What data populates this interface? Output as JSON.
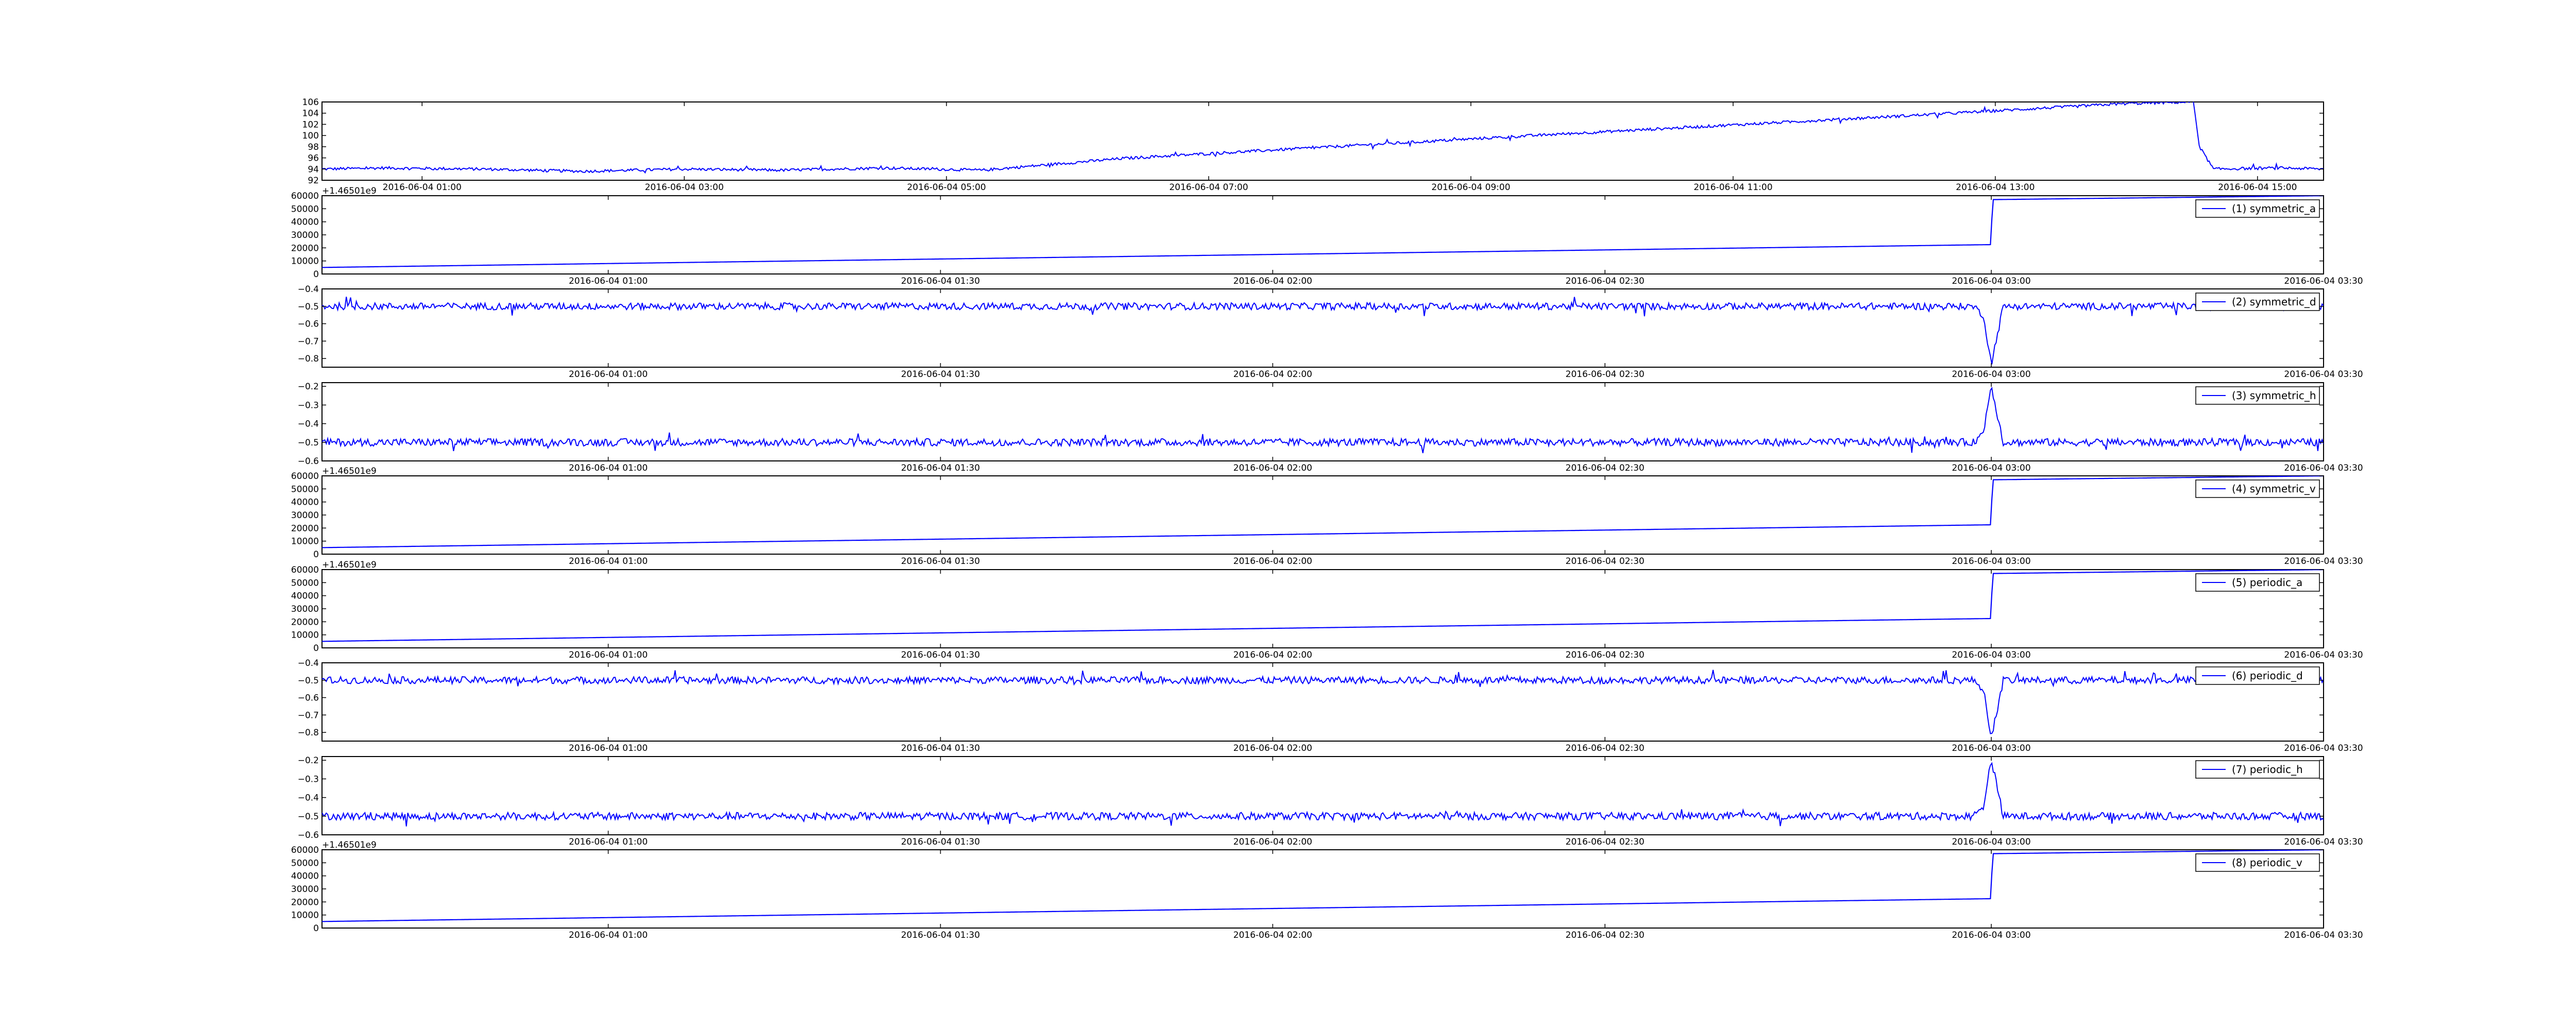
{
  "colors": {
    "series": "#0000ff",
    "axes": "#000000",
    "background": "#ffffff"
  },
  "chart_data": [
    {
      "type": "line",
      "legend": "",
      "offset_text": "",
      "ylim": [
        92,
        106
      ],
      "yticks": [
        92,
        94,
        96,
        98,
        100,
        102,
        104,
        106
      ],
      "ytick_labels": [
        "92",
        "94",
        "96",
        "98",
        "100",
        "102",
        "104",
        "106"
      ],
      "x_ticks": [
        {
          "value": 0.05,
          "label": "2016-06-04 01:00"
        },
        {
          "value": 0.181,
          "label": "2016-06-04 03:00"
        },
        {
          "value": 0.312,
          "label": "2016-06-04 05:00"
        },
        {
          "value": 0.443,
          "label": "2016-06-04 07:00"
        },
        {
          "value": 0.574,
          "label": "2016-06-04 09:00"
        },
        {
          "value": 0.705,
          "label": "2016-06-04 11:00"
        },
        {
          "value": 0.836,
          "label": "2016-06-04 13:00"
        },
        {
          "value": 0.967,
          "label": "2016-06-04 15:00"
        }
      ],
      "x": [
        0.0,
        0.03,
        0.08,
        0.13,
        0.18,
        0.23,
        0.28,
        0.33,
        0.4,
        0.5,
        0.6,
        0.7,
        0.8,
        0.9,
        0.935,
        0.938,
        0.945,
        0.96,
        0.98,
        1.0
      ],
      "y": [
        94.0,
        94.2,
        94.0,
        93.6,
        94.0,
        93.8,
        94.2,
        93.8,
        95.9,
        97.9,
        99.9,
        101.8,
        103.7,
        105.7,
        106.0,
        98.0,
        94.0,
        94.1,
        94.2,
        94.0
      ],
      "noise": 0.25
    },
    {
      "type": "line",
      "legend": "(1) symmetric_a",
      "offset_text": "+1.46501e9",
      "ylim": [
        0,
        60000
      ],
      "yticks": [
        0,
        10000,
        20000,
        30000,
        40000,
        50000,
        60000
      ],
      "ytick_labels": [
        "0",
        "10000",
        "20000",
        "30000",
        "40000",
        "50000",
        "60000"
      ],
      "x_ticks": [
        {
          "value": 0.143,
          "label": "2016-06-04 01:00"
        },
        {
          "value": 0.309,
          "label": "2016-06-04 01:30"
        },
        {
          "value": 0.475,
          "label": "2016-06-04 02:00"
        },
        {
          "value": 0.641,
          "label": "2016-06-04 02:30"
        },
        {
          "value": 0.834,
          "label": "2016-06-04 03:00"
        },
        {
          "value": 1.0,
          "label": "2016-06-04 03:30"
        }
      ],
      "x": [
        0.0,
        0.834,
        0.8345,
        1.0
      ],
      "y": [
        5000,
        22500,
        57000,
        60000
      ],
      "noise": 0
    },
    {
      "type": "line",
      "legend": "(2) symmetric_d",
      "offset_text": "",
      "ylim": [
        -0.85,
        -0.4
      ],
      "yticks": [
        -0.8,
        -0.7,
        -0.6,
        -0.5,
        -0.4
      ],
      "ytick_labels": [
        "−0.8",
        "−0.7",
        "−0.6",
        "−0.5",
        "−0.4"
      ],
      "x_ticks": [
        {
          "value": 0.143,
          "label": "2016-06-04 01:00"
        },
        {
          "value": 0.309,
          "label": "2016-06-04 01:30"
        },
        {
          "value": 0.475,
          "label": "2016-06-04 02:00"
        },
        {
          "value": 0.641,
          "label": "2016-06-04 02:30"
        },
        {
          "value": 0.834,
          "label": "2016-06-04 03:00"
        },
        {
          "value": 1.0,
          "label": "2016-06-04 03:30"
        }
      ],
      "x": [
        0.0,
        0.825,
        0.83,
        0.834,
        0.836,
        0.84,
        1.0
      ],
      "y": [
        -0.5,
        -0.5,
        -0.55,
        -0.83,
        -0.72,
        -0.5,
        -0.5
      ],
      "noise": 0.02
    },
    {
      "type": "line",
      "legend": "(3) symmetric_h",
      "offset_text": "",
      "ylim": [
        -0.6,
        -0.18
      ],
      "yticks": [
        -0.6,
        -0.5,
        -0.4,
        -0.3,
        -0.2
      ],
      "ytick_labels": [
        "−0.6",
        "−0.5",
        "−0.4",
        "−0.3",
        "−0.2"
      ],
      "x_ticks": [
        {
          "value": 0.143,
          "label": "2016-06-04 01:00"
        },
        {
          "value": 0.309,
          "label": "2016-06-04 01:30"
        },
        {
          "value": 0.475,
          "label": "2016-06-04 02:00"
        },
        {
          "value": 0.641,
          "label": "2016-06-04 02:30"
        },
        {
          "value": 0.834,
          "label": "2016-06-04 03:00"
        },
        {
          "value": 1.0,
          "label": "2016-06-04 03:30"
        }
      ],
      "x": [
        0.0,
        0.825,
        0.83,
        0.834,
        0.836,
        0.84,
        1.0
      ],
      "y": [
        -0.5,
        -0.5,
        -0.45,
        -0.19,
        -0.3,
        -0.5,
        -0.5
      ],
      "noise": 0.02
    },
    {
      "type": "line",
      "legend": "(4) symmetric_v",
      "offset_text": "+1.46501e9",
      "ylim": [
        0,
        60000
      ],
      "yticks": [
        0,
        10000,
        20000,
        30000,
        40000,
        50000,
        60000
      ],
      "ytick_labels": [
        "0",
        "10000",
        "20000",
        "30000",
        "40000",
        "50000",
        "60000"
      ],
      "x_ticks": [
        {
          "value": 0.143,
          "label": "2016-06-04 01:00"
        },
        {
          "value": 0.309,
          "label": "2016-06-04 01:30"
        },
        {
          "value": 0.475,
          "label": "2016-06-04 02:00"
        },
        {
          "value": 0.641,
          "label": "2016-06-04 02:30"
        },
        {
          "value": 0.834,
          "label": "2016-06-04 03:00"
        },
        {
          "value": 1.0,
          "label": "2016-06-04 03:30"
        }
      ],
      "x": [
        0.0,
        0.834,
        0.8345,
        1.0
      ],
      "y": [
        5000,
        22500,
        57000,
        60000
      ],
      "noise": 0
    },
    {
      "type": "line",
      "legend": "(5) periodic_a",
      "offset_text": "+1.46501e9",
      "ylim": [
        0,
        60000
      ],
      "yticks": [
        0,
        10000,
        20000,
        30000,
        40000,
        50000,
        60000
      ],
      "ytick_labels": [
        "0",
        "10000",
        "20000",
        "30000",
        "40000",
        "50000",
        "60000"
      ],
      "x_ticks": [
        {
          "value": 0.143,
          "label": "2016-06-04 01:00"
        },
        {
          "value": 0.309,
          "label": "2016-06-04 01:30"
        },
        {
          "value": 0.475,
          "label": "2016-06-04 02:00"
        },
        {
          "value": 0.641,
          "label": "2016-06-04 02:30"
        },
        {
          "value": 0.834,
          "label": "2016-06-04 03:00"
        },
        {
          "value": 1.0,
          "label": "2016-06-04 03:30"
        }
      ],
      "x": [
        0.0,
        0.834,
        0.8345,
        1.0
      ],
      "y": [
        5000,
        22500,
        57000,
        60000
      ],
      "noise": 0
    },
    {
      "type": "line",
      "legend": "(6) periodic_d",
      "offset_text": "",
      "ylim": [
        -0.85,
        -0.4
      ],
      "yticks": [
        -0.8,
        -0.7,
        -0.6,
        -0.5,
        -0.4
      ],
      "ytick_labels": [
        "−0.8",
        "−0.7",
        "−0.6",
        "−0.5",
        "−0.4"
      ],
      "x_ticks": [
        {
          "value": 0.143,
          "label": "2016-06-04 01:00"
        },
        {
          "value": 0.309,
          "label": "2016-06-04 01:30"
        },
        {
          "value": 0.475,
          "label": "2016-06-04 02:00"
        },
        {
          "value": 0.641,
          "label": "2016-06-04 02:30"
        },
        {
          "value": 0.834,
          "label": "2016-06-04 03:00"
        },
        {
          "value": 1.0,
          "label": "2016-06-04 03:30"
        }
      ],
      "x": [
        0.0,
        0.825,
        0.83,
        0.834,
        0.836,
        0.84,
        1.0
      ],
      "y": [
        -0.5,
        -0.5,
        -0.55,
        -0.83,
        -0.72,
        -0.5,
        -0.5
      ],
      "noise": 0.02
    },
    {
      "type": "line",
      "legend": "(7) periodic_h",
      "offset_text": "",
      "ylim": [
        -0.6,
        -0.18
      ],
      "yticks": [
        -0.6,
        -0.5,
        -0.4,
        -0.3,
        -0.2
      ],
      "ytick_labels": [
        "−0.6",
        "−0.5",
        "−0.4",
        "−0.3",
        "−0.2"
      ],
      "x_ticks": [
        {
          "value": 0.143,
          "label": "2016-06-04 01:00"
        },
        {
          "value": 0.309,
          "label": "2016-06-04 01:30"
        },
        {
          "value": 0.475,
          "label": "2016-06-04 02:00"
        },
        {
          "value": 0.641,
          "label": "2016-06-04 02:30"
        },
        {
          "value": 0.834,
          "label": "2016-06-04 03:00"
        },
        {
          "value": 1.0,
          "label": "2016-06-04 03:30"
        }
      ],
      "x": [
        0.0,
        0.825,
        0.83,
        0.834,
        0.836,
        0.84,
        1.0
      ],
      "y": [
        -0.5,
        -0.5,
        -0.45,
        -0.19,
        -0.3,
        -0.5,
        -0.5
      ],
      "noise": 0.02
    },
    {
      "type": "line",
      "legend": "(8) periodic_v",
      "offset_text": "+1.46501e9",
      "ylim": [
        0,
        60000
      ],
      "yticks": [
        0,
        10000,
        20000,
        30000,
        40000,
        50000,
        60000
      ],
      "ytick_labels": [
        "0",
        "10000",
        "20000",
        "30000",
        "40000",
        "50000",
        "60000"
      ],
      "x_ticks": [
        {
          "value": 0.143,
          "label": "2016-06-04 01:00"
        },
        {
          "value": 0.309,
          "label": "2016-06-04 01:30"
        },
        {
          "value": 0.475,
          "label": "2016-06-04 02:00"
        },
        {
          "value": 0.641,
          "label": "2016-06-04 02:30"
        },
        {
          "value": 0.834,
          "label": "2016-06-04 03:00"
        },
        {
          "value": 1.0,
          "label": "2016-06-04 03:30"
        }
      ],
      "x": [
        0.0,
        0.834,
        0.8345,
        1.0
      ],
      "y": [
        5000,
        22500,
        57000,
        60000
      ],
      "noise": 0
    }
  ]
}
